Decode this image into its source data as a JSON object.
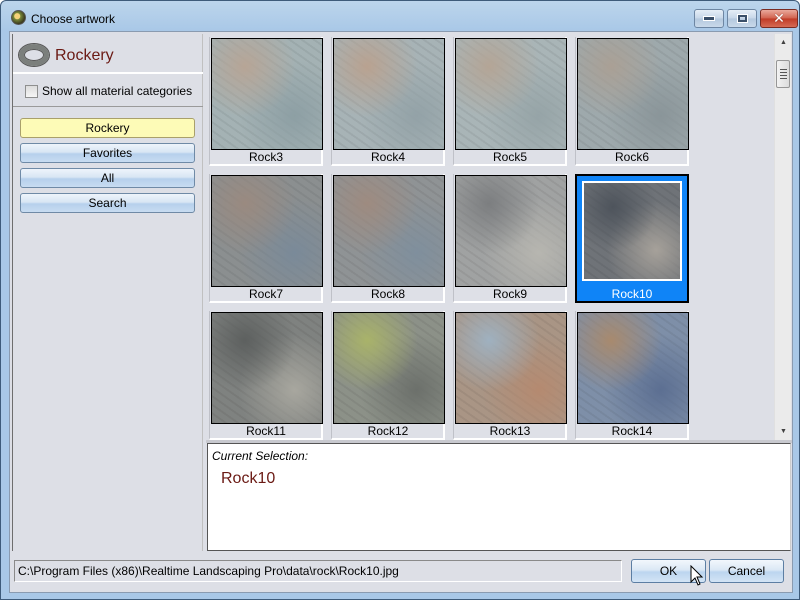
{
  "window": {
    "title": "Choose artwork",
    "controls": {
      "minimize": "minimize",
      "maximize": "maximize",
      "close": "✕"
    }
  },
  "sidebar": {
    "category_title": "Rockery",
    "show_all_label": "Show all material categories",
    "show_all_checked": false,
    "buttons": [
      {
        "label": "Rockery",
        "active": true
      },
      {
        "label": "Favorites",
        "active": false
      },
      {
        "label": "All",
        "active": false
      },
      {
        "label": "Search",
        "active": false
      }
    ]
  },
  "grid": {
    "items": [
      {
        "label": "Rock3",
        "colors": [
          "#a4b2b4",
          "#b7a596",
          "#8d9fa4"
        ],
        "selected": false
      },
      {
        "label": "Rock4",
        "colors": [
          "#a7b3b6",
          "#b9a290",
          "#93a2a7"
        ],
        "selected": false
      },
      {
        "label": "Rock5",
        "colors": [
          "#a9b5b7",
          "#b4a596",
          "#96a4a7"
        ],
        "selected": false
      },
      {
        "label": "Rock6",
        "colors": [
          "#9ea9ac",
          "#aaa095",
          "#8a9599"
        ],
        "selected": false
      },
      {
        "label": "Rock7",
        "colors": [
          "#8b8f90",
          "#9a8a80",
          "#7a8a99"
        ],
        "selected": false
      },
      {
        "label": "Rock8",
        "colors": [
          "#8f9395",
          "#9e8b80",
          "#7f8f9d"
        ],
        "selected": false
      },
      {
        "label": "Rock9",
        "colors": [
          "#a0a2a2",
          "#7c7e80",
          "#b7b6b0"
        ],
        "selected": false
      },
      {
        "label": "Rock10",
        "colors": [
          "#6f7378",
          "#4e545c",
          "#a6a19a"
        ],
        "selected": true
      },
      {
        "label": "Rock11",
        "colors": [
          "#7f8280",
          "#5d605f",
          "#a8a79f"
        ],
        "selected": false
      },
      {
        "label": "Rock12",
        "colors": [
          "#8c9188",
          "#a9b36a",
          "#6c706b"
        ],
        "selected": false
      },
      {
        "label": "Rock13",
        "colors": [
          "#a99585",
          "#9fb1c0",
          "#b58a70"
        ],
        "selected": false
      },
      {
        "label": "Rock14",
        "colors": [
          "#7e8fa8",
          "#a88a6e",
          "#5c6f92"
        ],
        "selected": false
      }
    ]
  },
  "selection": {
    "caption": "Current Selection:",
    "value": "Rock10"
  },
  "footer": {
    "path": "C:\\Program Files (x86)\\Realtime Landscaping Pro\\data\\rock\\Rock10.jpg",
    "ok_label": "OK",
    "cancel_label": "Cancel"
  },
  "colors": {
    "selected_tile": "#0f84f7",
    "active_category": "#fdfbb7",
    "title_accent": "#6b1a14"
  }
}
